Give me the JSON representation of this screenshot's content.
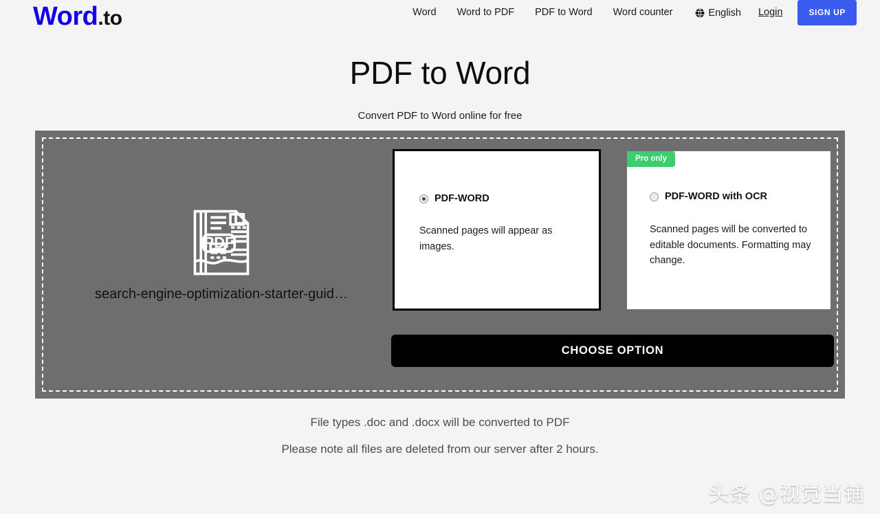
{
  "header": {
    "logo": {
      "primary": "Word",
      "suffix": ".to"
    },
    "nav_items": [
      {
        "label": "Word",
        "name": "nav-word"
      },
      {
        "label": "Word to PDF",
        "name": "nav-word-to-pdf"
      },
      {
        "label": "PDF to Word",
        "name": "nav-pdf-to-word"
      },
      {
        "label": "Word counter",
        "name": "nav-word-counter"
      }
    ],
    "language": {
      "label": "English",
      "icon": "globe-icon"
    },
    "login_label": "Login",
    "signup_label": "SIGN UP",
    "signup_color": "#3a5bf0"
  },
  "hero": {
    "title": "PDF to Word",
    "subtitle": "Convert PDF to Word online for free"
  },
  "dropzone": {
    "background_color": "#6e6e6e",
    "file": {
      "icon": "pdf-file-icon",
      "icon_label": "PDF",
      "name": "search-engine-optimization-starter-guid…"
    },
    "options": [
      {
        "id": "pdf-word",
        "label": "PDF-WORD",
        "description": "Scanned pages will appear as images.",
        "selected": true,
        "badge": null
      },
      {
        "id": "pdf-word-ocr",
        "label": "PDF-WORD with OCR",
        "description": "Scanned pages will be converted to editable documents. Formatting may change.",
        "selected": false,
        "badge": "Pro only",
        "badge_color": "#3ace6e"
      }
    ],
    "choose_button_label": "CHOOSE OPTION"
  },
  "notes": {
    "line1": "File types .doc and .docx will be converted to PDF",
    "line2": "Please note all files are deleted from our server after 2 hours."
  },
  "watermark": {
    "text": "头条 @视觉当铺"
  }
}
